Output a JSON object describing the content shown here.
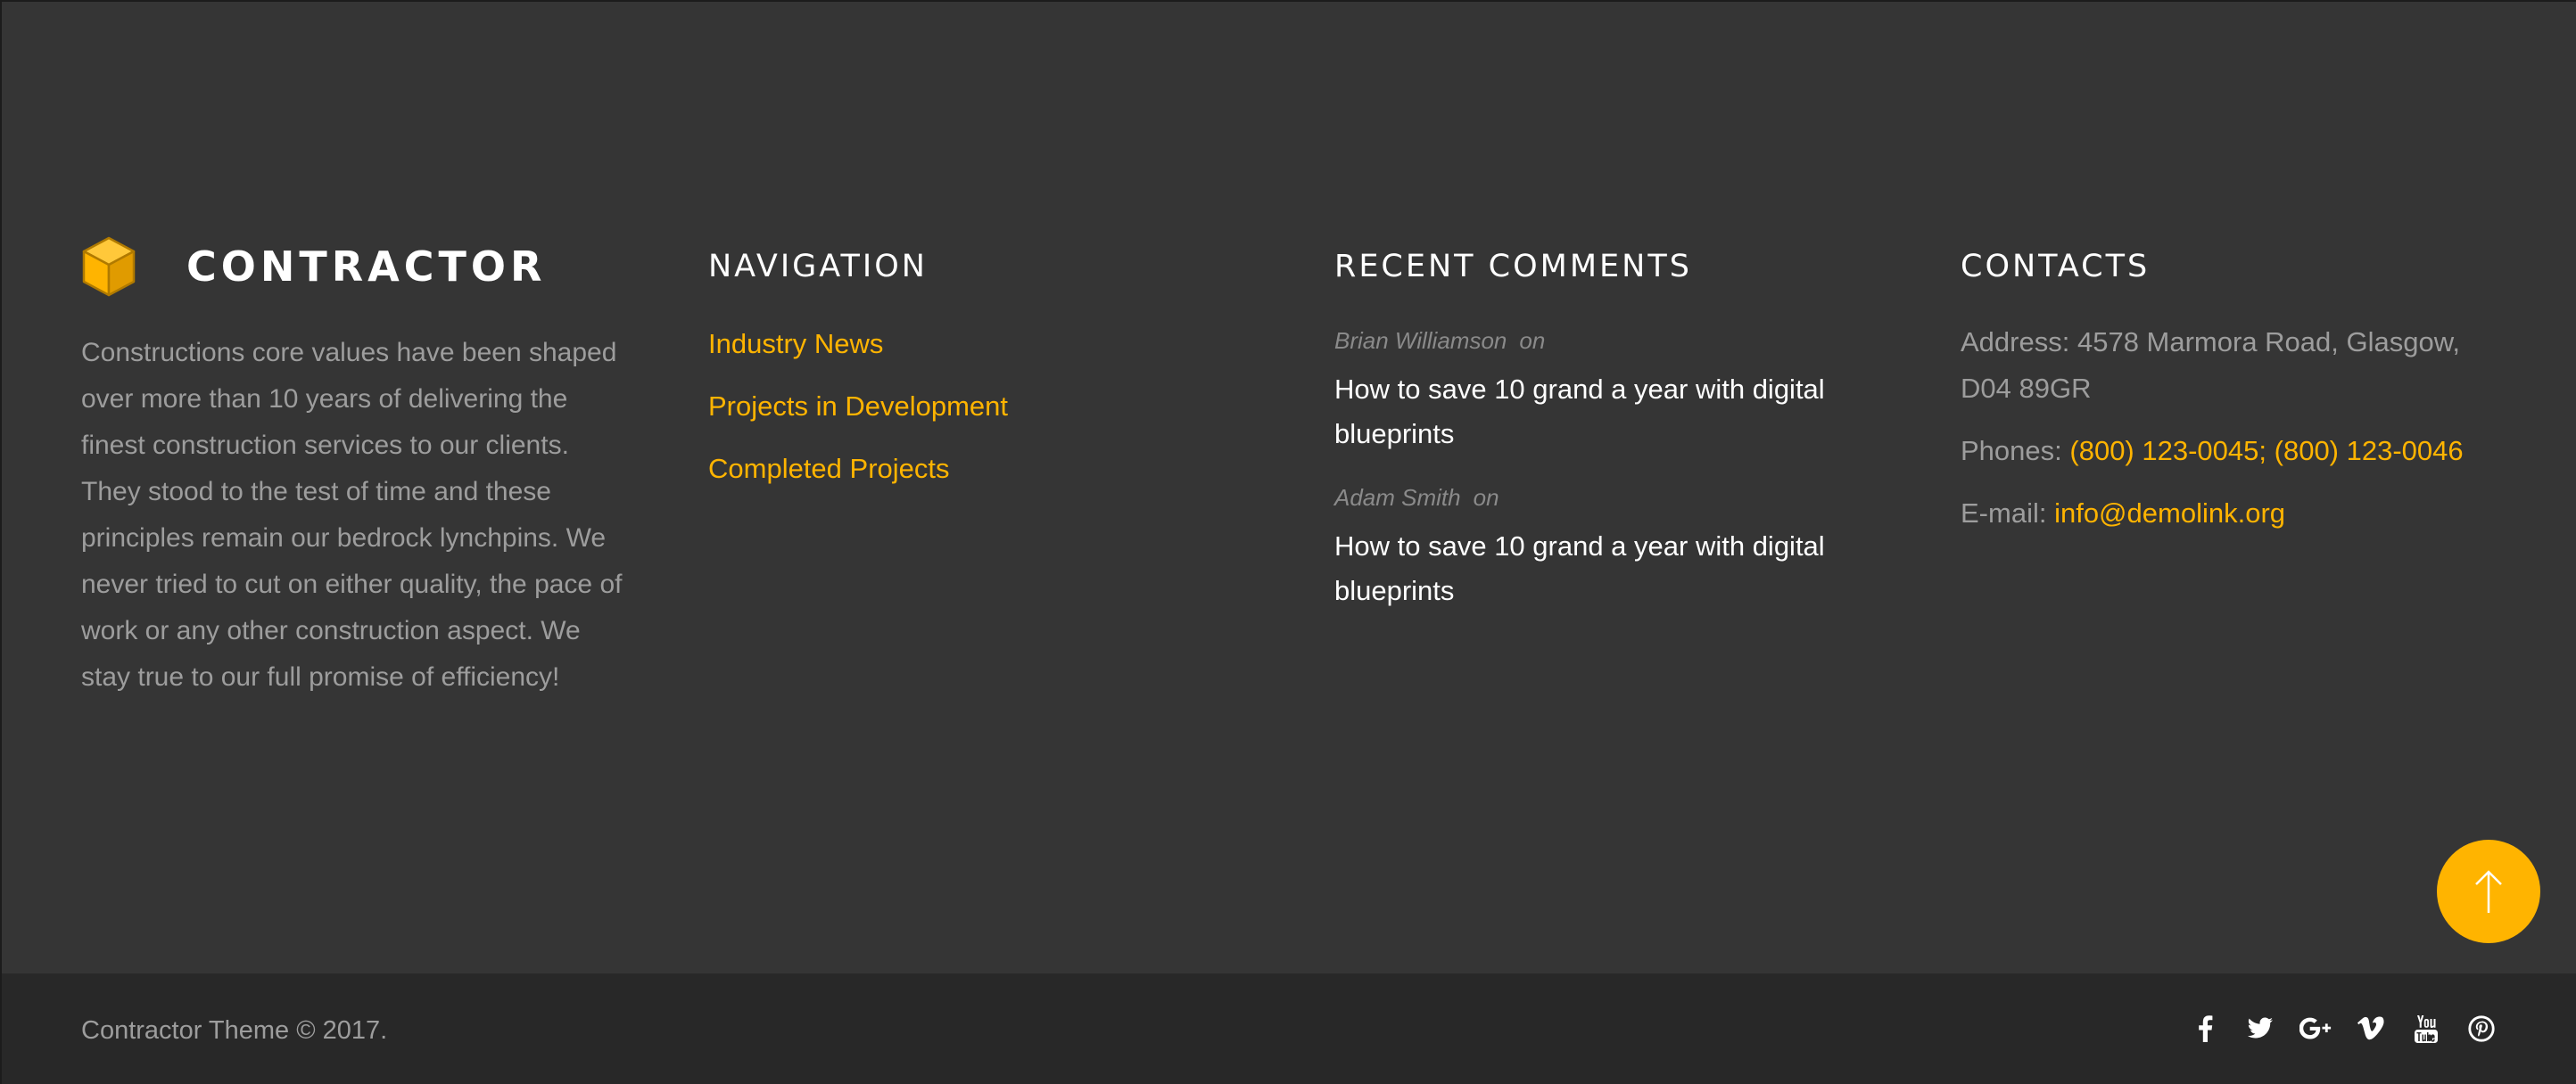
{
  "brand": {
    "name": "CONTRACTOR",
    "description": "Constructions core values have been shaped over more than 10 years of delivering the finest construction services to our clients. They stood to the test of time and these principles remain our bedrock lynchpins. We never tried to cut on either quality, the pace of work or any other construction aspect. We stay true to our full promise of efficiency!",
    "icon": "cube-icon"
  },
  "navigation": {
    "title": "NAVIGATION",
    "links": [
      {
        "label": "Industry News"
      },
      {
        "label": "Projects in Development"
      },
      {
        "label": "Completed Projects"
      }
    ]
  },
  "comments": {
    "title": "RECENT COMMENTS",
    "items": [
      {
        "author": "Brian Williamson",
        "on": "on",
        "post": "How to save 10 grand a year with digital blueprints"
      },
      {
        "author": "Adam Smith",
        "on": "on",
        "post": "How to save 10 grand a year with digital blueprints"
      }
    ]
  },
  "contacts": {
    "title": "CONTACTS",
    "address_label": "Address:",
    "address": "4578 Marmora Road, Glasgow, D04 89GR",
    "phones_label": "Phones:",
    "phone1": "(800) 123-0045",
    "phone_separator": ";",
    "phone2": "(800) 123-0046",
    "email_label": "E-mail:",
    "email": "info@demolink.org"
  },
  "back_to_top": {
    "icon": "arrow-up-icon"
  },
  "bottom": {
    "copyright": "Contractor Theme © 2017.",
    "socials": [
      {
        "icon": "facebook-icon"
      },
      {
        "icon": "twitter-icon"
      },
      {
        "icon": "google-plus-icon"
      },
      {
        "icon": "vimeo-icon"
      },
      {
        "icon": "youtube-icon"
      },
      {
        "icon": "pinterest-icon"
      }
    ]
  },
  "colors": {
    "accent": "#ffb400",
    "background": "#353535",
    "bottom_bar": "#282828",
    "text_muted": "#9d9d9d",
    "heading": "#ffffff"
  }
}
